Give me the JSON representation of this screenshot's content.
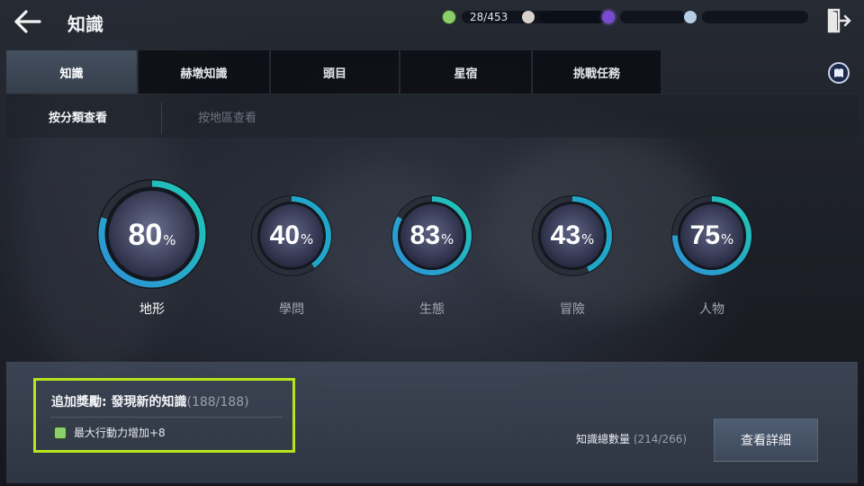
{
  "header": {
    "title": "知識",
    "currencies": [
      {
        "icon": "action-power-icon",
        "value": "28/453",
        "color": "#8ccf6a"
      },
      {
        "icon": "silver-coin-icon",
        "value": "",
        "color": "#d9d2cc"
      },
      {
        "icon": "purple-gem-icon",
        "value": "",
        "color": "#7a4bd0"
      },
      {
        "icon": "blue-silver-icon",
        "value": "",
        "color": "#b7cde6"
      }
    ]
  },
  "tabs": [
    {
      "label": "知識",
      "active": true
    },
    {
      "label": "赫墩知識",
      "active": false
    },
    {
      "label": "頭目",
      "active": false
    },
    {
      "label": "星宿",
      "active": false
    },
    {
      "label": "挑戰任務",
      "active": false
    }
  ],
  "subtabs": [
    {
      "label": "按分類查看",
      "active": true
    },
    {
      "label": "按地區查看",
      "active": false
    }
  ],
  "categories": [
    {
      "label": "地形",
      "percent": 80,
      "unit": "%",
      "selected": true
    },
    {
      "label": "學問",
      "percent": 40,
      "unit": "%",
      "selected": false
    },
    {
      "label": "生態",
      "percent": 83,
      "unit": "%",
      "selected": false
    },
    {
      "label": "冒險",
      "percent": 43,
      "unit": "%",
      "selected": false
    },
    {
      "label": "人物",
      "percent": 75,
      "unit": "%",
      "selected": false
    }
  ],
  "bonus": {
    "title": "追加獎勵: 發現新的知識",
    "count": "(188/188)",
    "reward": "最大行動力增加+8"
  },
  "total": {
    "label": "知識總數量",
    "count": "(214/266)"
  },
  "detail_button": "查看詳細",
  "colors": {
    "accent_teal": "#1fc8b4",
    "accent_blue": "#2d8fd8",
    "highlight": "#b5e61d"
  }
}
